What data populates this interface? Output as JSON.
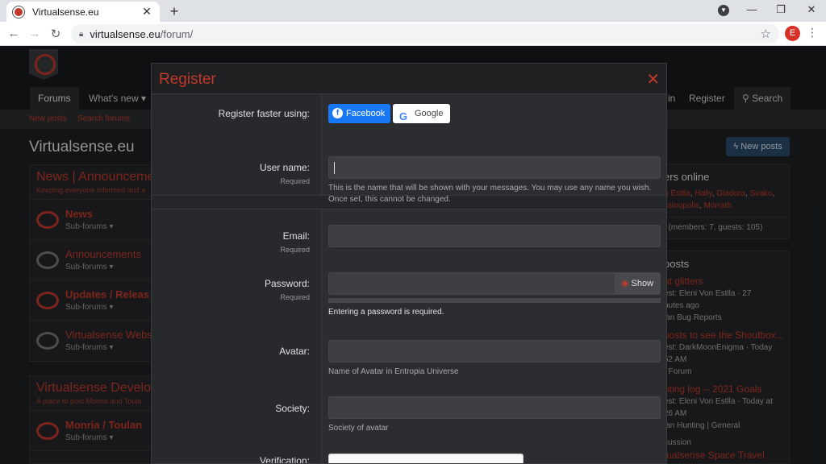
{
  "browser": {
    "tab_title": "Virtualsense.eu",
    "tab_close": "✕",
    "new_tab": "+",
    "url_host": "virtualsense.eu",
    "url_path": "/forum/",
    "profile_letter": "E"
  },
  "nav": {
    "forums": "Forums",
    "whats_new": "What's new ▾",
    "login_partial": "in",
    "register": "Register",
    "search": "Search"
  },
  "subnav": {
    "new_posts": "New posts",
    "search_forums": "Search forums"
  },
  "page_title": "Virtualsense.eu",
  "categories": [
    {
      "title": "News | Announceme",
      "desc": "Keeping everyone informed and a",
      "nodes": [
        {
          "title": "News",
          "sub": "Sub-forums ▾",
          "active": true
        },
        {
          "title": "Announcements",
          "sub": "Sub-forums ▾",
          "active": false
        },
        {
          "title": "Updates / Releas",
          "sub": "Sub-forums ▾",
          "active": true
        },
        {
          "title": "Virtualsense Webs",
          "sub": "Sub-forums ▾",
          "active": false
        }
      ]
    },
    {
      "title": "Virtualsense Develop",
      "desc": "A place to post Monria and Toula",
      "nodes": [
        {
          "title": "Monria / Toulan",
          "sub": "Sub-forums ▾",
          "active": true
        }
      ]
    }
  ],
  "sidebar": {
    "new_posts_button": "New posts",
    "members_title": "ers online",
    "members_line1_names": [
      "n Estlla",
      "Hally",
      "Gladora",
      "Svako"
    ],
    "members_line2_names": [
      "ssinopolis",
      "Morrath"
    ],
    "members_total": ": (members: 7, guests: 105)",
    "latest_title": "posts",
    "posts": [
      {
        "title": "ht glitters",
        "line1": "est: Eleni Von Estlla · 27",
        "line2": "nutes ago",
        "line3": "lan Bug Reports"
      },
      {
        "title": "posts to see the Shoutbox...",
        "line1": "est: DarkMoonEnigma · Today",
        "line2": "52 AM",
        "line3": "t Forum"
      },
      {
        "title": "nting log -- 2021 Goals",
        "line1": "est: Eleni Von Estlla · Today at",
        "line2": "26 AM",
        "line3": "lan Hunting | General"
      },
      {
        "title": "tualsense Space Travel",
        "line1": "",
        "line2": "",
        "line3": "cussion"
      }
    ]
  },
  "modal": {
    "title": "Register",
    "close": "✕",
    "register_faster": "Register faster using:",
    "facebook": "Facebook",
    "google": "Google",
    "fields": {
      "username": {
        "label": "User name:",
        "required": "Required",
        "value": "",
        "hint": "This is the name that will be shown with your messages. You may use any name you wish. Once set, this cannot be changed."
      },
      "email": {
        "label": "Email:",
        "required": "Required",
        "value": ""
      },
      "password": {
        "label": "Password:",
        "required": "Required",
        "value": "",
        "show": "Show",
        "hint": "Entering a password is required."
      },
      "avatar": {
        "label": "Avatar:",
        "value": "",
        "hint": "Name of Avatar in Entropia Universe"
      },
      "society": {
        "label": "Society:",
        "value": "",
        "hint": "Society of avatar"
      },
      "verification": {
        "label": "Verification:"
      }
    }
  }
}
